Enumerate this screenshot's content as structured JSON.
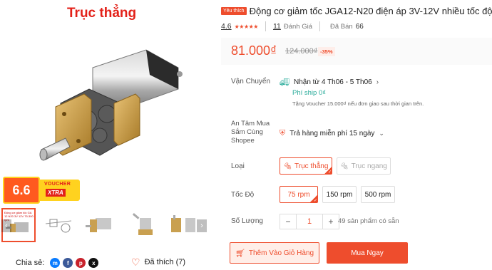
{
  "gallery": {
    "promo_title": "Trục thẳng",
    "rating_badge": "6.6",
    "badge_voucher": "VOUCHER",
    "badge_xtra": "XTRA",
    "thumb_caption": "Động cơ giảm tốc GA 12 N20 3V 12V 75-300 rpm",
    "prev_icon": "chevron-left-icon",
    "next_icon": "chevron-right-icon"
  },
  "share": {
    "label": "Chia sẻ:",
    "icons": [
      "messenger-icon",
      "facebook-icon",
      "pinterest-icon",
      "x-icon"
    ]
  },
  "favorite": {
    "label": "Đã thích (7)"
  },
  "product": {
    "badge": "Yêu thích",
    "title": "Động cơ giảm tốc JGA12-N20 điện áp 3V-12V nhiều tốc độ",
    "rating": "4.6",
    "review_count": "11",
    "review_label": "Đánh Giá",
    "sold_label": "Đã Bán",
    "sold_count": "66"
  },
  "price": {
    "current": "81.000₫",
    "original": "124.000₫",
    "discount": "-35%"
  },
  "shipping": {
    "label": "Vận Chuyển",
    "eta": "Nhận từ 4 Th06 - 5 Th06",
    "fee": "Phí ship 0₫",
    "voucher_note": "Tặng Voucher 15.000₫ nếu đơn giao sau thời gian trên."
  },
  "guarantee": {
    "label": "An Tâm Mua Sắm Cùng Shopee",
    "text": "Trả hàng miễn phí 15 ngày"
  },
  "type": {
    "label": "Loại",
    "options": [
      "Trục thẳng",
      "Trục ngang"
    ],
    "selected": "Trục thẳng"
  },
  "speed": {
    "label": "Tốc Độ",
    "options": [
      "75 rpm",
      "150 rpm",
      "500 rpm"
    ],
    "selected": "75 rpm"
  },
  "quantity": {
    "label": "Số Lượng",
    "minus": "−",
    "value": "1",
    "plus": "+",
    "stock": "49 sản phẩm có sẵn"
  },
  "actions": {
    "add_to_cart": "Thêm Vào Giỏ Hàng",
    "buy_now": "Mua Ngay"
  },
  "colors": {
    "accent": "#ee4d2d",
    "teal": "#26aa99",
    "badge_yellow": "#ffd21f"
  }
}
